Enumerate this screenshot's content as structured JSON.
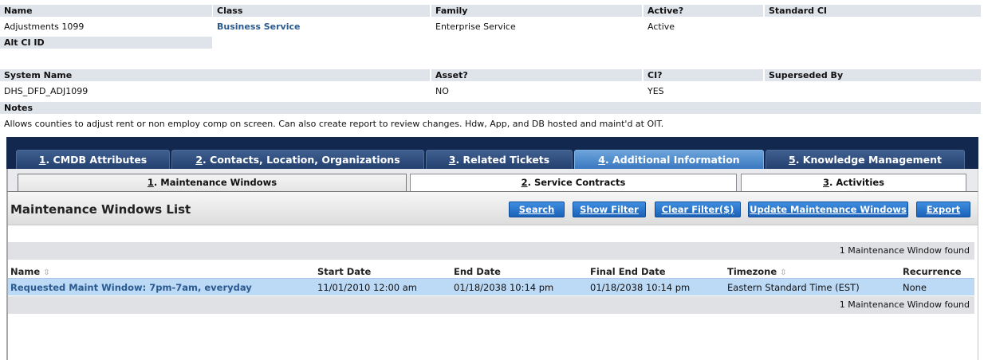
{
  "details": {
    "name_label": "Name",
    "name_value": "Adjustments 1099",
    "class_label": "Class",
    "class_value": "Business Service",
    "family_label": "Family",
    "family_value": "Enterprise Service",
    "active_label": "Active?",
    "active_value": "Active",
    "standard_ci_label": "Standard CI",
    "alt_ci_label": "Alt CI ID",
    "system_name_label": "System Name",
    "system_name_value": "DHS_DFD_ADJ1099",
    "asset_label": "Asset?",
    "asset_value": "NO",
    "ci_label": "CI?",
    "ci_value": "YES",
    "superseded_label": "Superseded By",
    "notes_label": "Notes",
    "notes_value": "Allows counties to adjust rent or non employ comp on screen. Can also create report to review changes. Hdw, App, and DB hosted and maint'd at OIT."
  },
  "tabs": [
    {
      "num": "1",
      "label": ". CMDB Attributes"
    },
    {
      "num": "2",
      "label": ". Contacts, Location, Organizations"
    },
    {
      "num": "3",
      "label": ". Related Tickets"
    },
    {
      "num": "4",
      "label": ". Additional Information"
    },
    {
      "num": "5",
      "label": ". Knowledge Management"
    }
  ],
  "subtabs": [
    {
      "num": "1",
      "label": ". Maintenance Windows"
    },
    {
      "num": "2",
      "label": ". Service Contracts"
    },
    {
      "num": "3",
      "label": ". Activities"
    }
  ],
  "list": {
    "title": "Maintenance Windows List",
    "buttons": {
      "search": "Search",
      "show_filter": "Show Filter",
      "clear_filter": "Clear Filter($)",
      "update": "Update Maintenance Windows",
      "export": "Export"
    },
    "count_text": "1 Maintenance Window found",
    "columns": {
      "name": "Name",
      "start": "Start Date",
      "end": "End Date",
      "final_end": "Final End Date",
      "timezone": "Timezone",
      "recurrence": "Recurrence"
    },
    "sort_glyph": "⇳",
    "row": {
      "name": "Requested Maint Window: 7pm-7am, everyday",
      "start": "11/01/2010 12:00 am",
      "end": "01/18/2038 10:14 pm",
      "final_end": "01/18/2038 10:14 pm",
      "timezone": "Eastern Standard Time (EST)",
      "recurrence": "None"
    }
  },
  "colors": {
    "header_bg": "#dfe3ea",
    "link": "#2a5a8f",
    "tabbar_bg": "#13284f",
    "active_tab": "#4a88cc",
    "button": "#1a62b8",
    "row_highlight": "#bcd9f5"
  }
}
